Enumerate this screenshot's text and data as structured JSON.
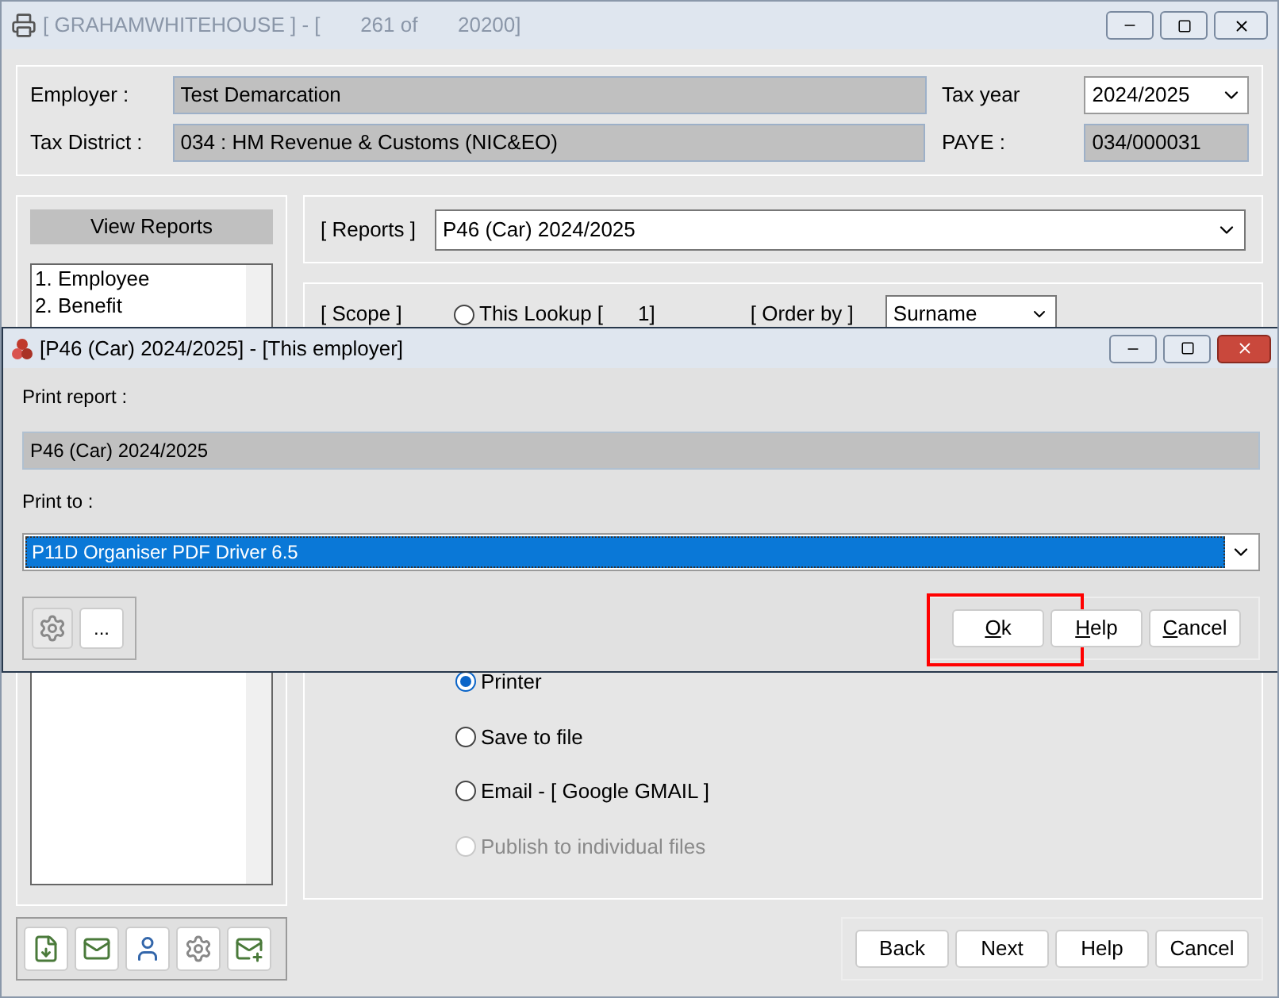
{
  "main_window": {
    "title": "[ GRAHAMWHITEHOUSE ] - [       261 of       20200]"
  },
  "header": {
    "employer_label": "Employer :",
    "employer": "Test Demarcation",
    "tax_year_label": "Tax year",
    "tax_year": "2024/2025",
    "district_label": "Tax District :",
    "district": "034 : HM Revenue & Customs (NIC&EO)",
    "paye_label": "PAYE :",
    "paye": "034/000031"
  },
  "sidebar": {
    "title": "View Reports",
    "items": [
      {
        "label": "1. Employee",
        "selected": false
      },
      {
        "label": "2. Benefit",
        "selected": false
      }
    ]
  },
  "reports": {
    "label": "[ Reports ]",
    "value": "P46 (Car) 2024/2025"
  },
  "scope": {
    "label": "[ Scope ]",
    "option": "This Lookup [",
    "count": "1]",
    "selected": false,
    "order_label": "[ Order by ]",
    "order": "Surname"
  },
  "output_options": [
    {
      "label": "Printer",
      "selected": true,
      "disabled": false
    },
    {
      "label": "Save to file",
      "selected": false,
      "disabled": false
    },
    {
      "label": "Email - [ Google GMAIL ]",
      "selected": false,
      "disabled": false
    },
    {
      "label": "Publish to individual files",
      "selected": false,
      "disabled": true
    }
  ],
  "buttons": [
    "Back",
    "Next",
    "Help",
    "Cancel"
  ],
  "dialog": {
    "title": "[P46 (Car) 2024/2025] - [This employer]",
    "report_label": "Print report :",
    "report": "P46 (Car) 2024/2025",
    "print_to_label": "Print to :",
    "printer": "P11D Organiser PDF Driver 6.5",
    "more_button": "...",
    "buttons": [
      {
        "key": "O",
        "rest": "k",
        "highlighted": true
      },
      {
        "key": "H",
        "rest": "elp",
        "highlighted": false
      },
      {
        "key": "C",
        "rest": "ancel",
        "highlighted": false
      }
    ]
  }
}
